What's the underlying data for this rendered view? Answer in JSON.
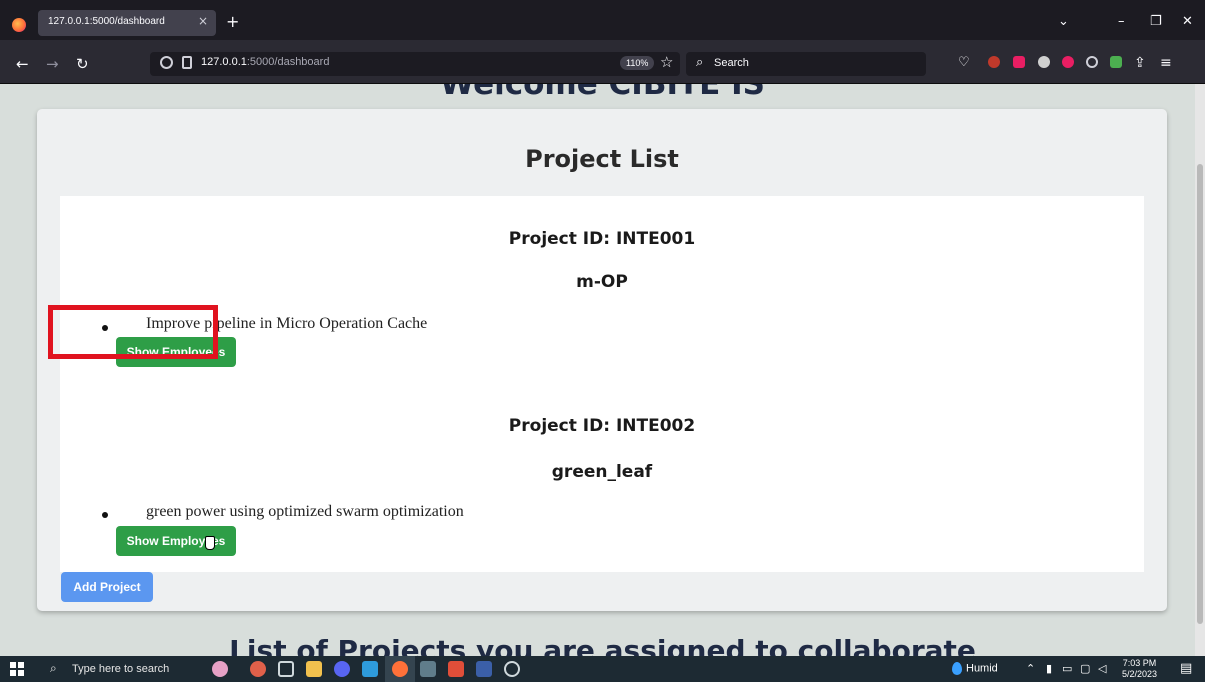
{
  "browser": {
    "tab_title": "127.0.0.1:5000/dashboard",
    "tab_close": "×",
    "new_tab": "+",
    "url_host": "127.0.0.1",
    "url_path": ":5000/dashboard",
    "zoom": "110%",
    "search_placeholder": "Search",
    "window_controls": {
      "dropdown": "⌄",
      "minimize": "–",
      "restore": "❐",
      "close": "✕"
    }
  },
  "page": {
    "welcome_text": "Welcome CIBITE IS",
    "card_title": "Project List",
    "projects": [
      {
        "id_label": "Project ID: INTE001",
        "name": "m-OP",
        "description": "Improve pipeline in Micro Operation Cache",
        "button": "Show Employees"
      },
      {
        "id_label": "Project ID: INTE002",
        "name": "green_leaf",
        "description": "green power using optimized swarm optimization",
        "button": "Show Employees"
      }
    ],
    "add_project": "Add Project",
    "list_heading": "List of Projects you are assigned to collaborate"
  },
  "taskbar": {
    "search_placeholder": "Type here to search",
    "weather": "Humid",
    "time": "7:03 PM",
    "date": "5/2/2023"
  },
  "colors": {
    "highlight": "#e0131f",
    "green_button": "#2e9e47",
    "blue_button": "#5b97f0"
  }
}
